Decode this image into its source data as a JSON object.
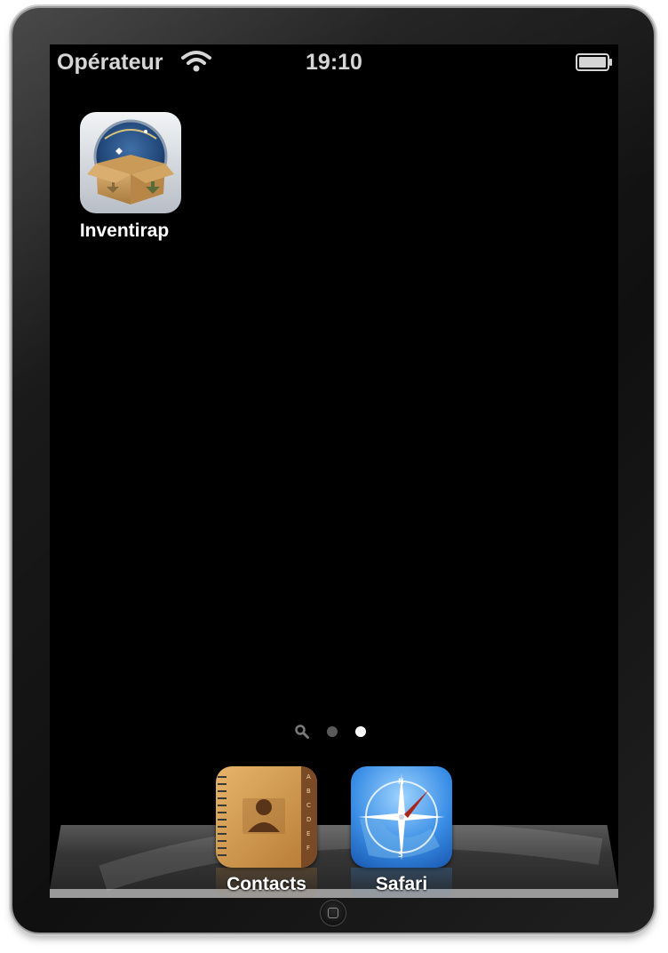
{
  "status_bar": {
    "carrier": "Opérateur",
    "time": "19:10",
    "wifi_icon": "wifi-icon",
    "battery_icon": "battery-icon"
  },
  "home_screen": {
    "apps": [
      {
        "label": "Inventirap",
        "icon": "box-globe-icon"
      }
    ],
    "page_indicator": {
      "pages": 2,
      "current_page": 2,
      "has_spotlight": true
    }
  },
  "dock": {
    "apps": [
      {
        "label": "Contacts",
        "icon": "contacts-book-icon"
      },
      {
        "label": "Safari",
        "icon": "compass-icon"
      }
    ]
  },
  "device": {
    "home_button": "home-button"
  },
  "colors": {
    "screen_bg": "#000000",
    "status_text": "#d6d6d6",
    "label_text": "#ffffff",
    "dot_active": "#ffffff",
    "dot_inactive": "#5a5a5a"
  }
}
